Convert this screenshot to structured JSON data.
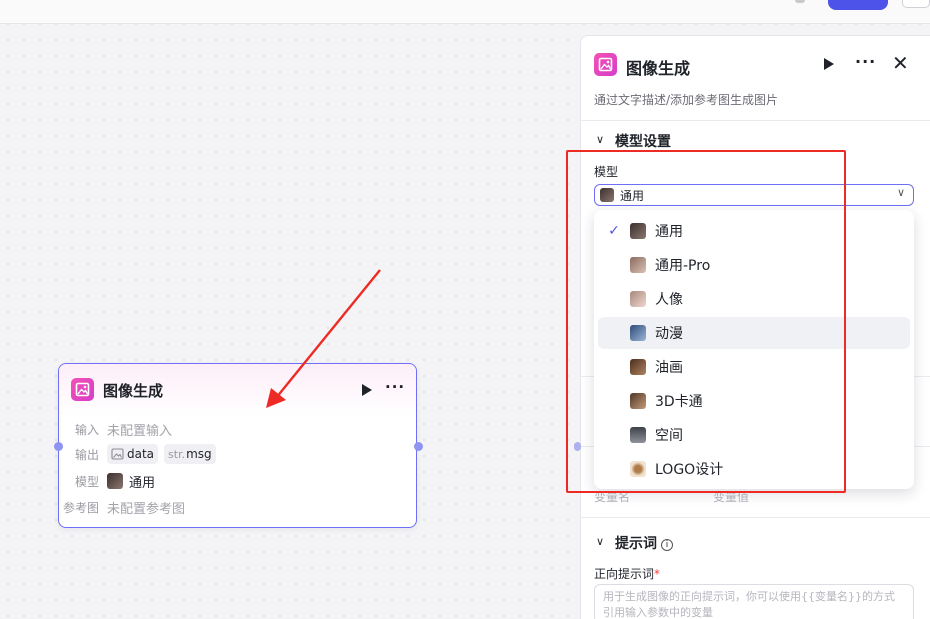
{
  "node": {
    "title": "图像生成",
    "rows": {
      "input_label": "输入",
      "input_value": "未配置输入",
      "output_label": "输出",
      "output_tags": [
        {
          "prefix": "",
          "name": "data"
        },
        {
          "prefix": "str.",
          "name": "msg"
        }
      ],
      "model_label": "模型",
      "model_value": "通用",
      "ref_label": "参考图",
      "ref_value": "未配置参考图"
    }
  },
  "panel": {
    "title": "图像生成",
    "description": "通过文字描述/添加参考图生成图片",
    "model_section": {
      "title": "模型设置",
      "field_label": "模型",
      "selected": "通用"
    },
    "variables": {
      "col_name": "变量名",
      "col_value": "变量值"
    },
    "prompt_section": {
      "title": "提示词",
      "positive_label": "正向提示词",
      "required_mark": "*",
      "placeholder_line1": "用于生成图像的正向提示词，你可以使用{{变量名}}的方式",
      "placeholder_line2": "引用输入参数中的变量"
    }
  },
  "dropdown": {
    "options": [
      {
        "label": "通用",
        "selected": true,
        "hover": false,
        "color": "#6b5a55"
      },
      {
        "label": "通用-Pro",
        "selected": false,
        "hover": false,
        "color": "#b89a8a"
      },
      {
        "label": "人像",
        "selected": false,
        "hover": false,
        "color": "#c9a49a"
      },
      {
        "label": "动漫",
        "selected": false,
        "hover": true,
        "color": "#4f6f9a"
      },
      {
        "label": "油画",
        "selected": false,
        "hover": false,
        "color": "#6e4a32"
      },
      {
        "label": "3D卡通",
        "selected": false,
        "hover": false,
        "color": "#7a5a44"
      },
      {
        "label": "空间",
        "selected": false,
        "hover": false,
        "color": "#5b5f66"
      },
      {
        "label": "LOGO设计",
        "selected": false,
        "hover": false,
        "color": "#e3c9a6"
      }
    ]
  },
  "colors": {
    "accent": "#4d53e8",
    "node_border": "#6e6ff5",
    "annotation_red": "#ee2a24",
    "icon_pink": "#e24ac0"
  }
}
